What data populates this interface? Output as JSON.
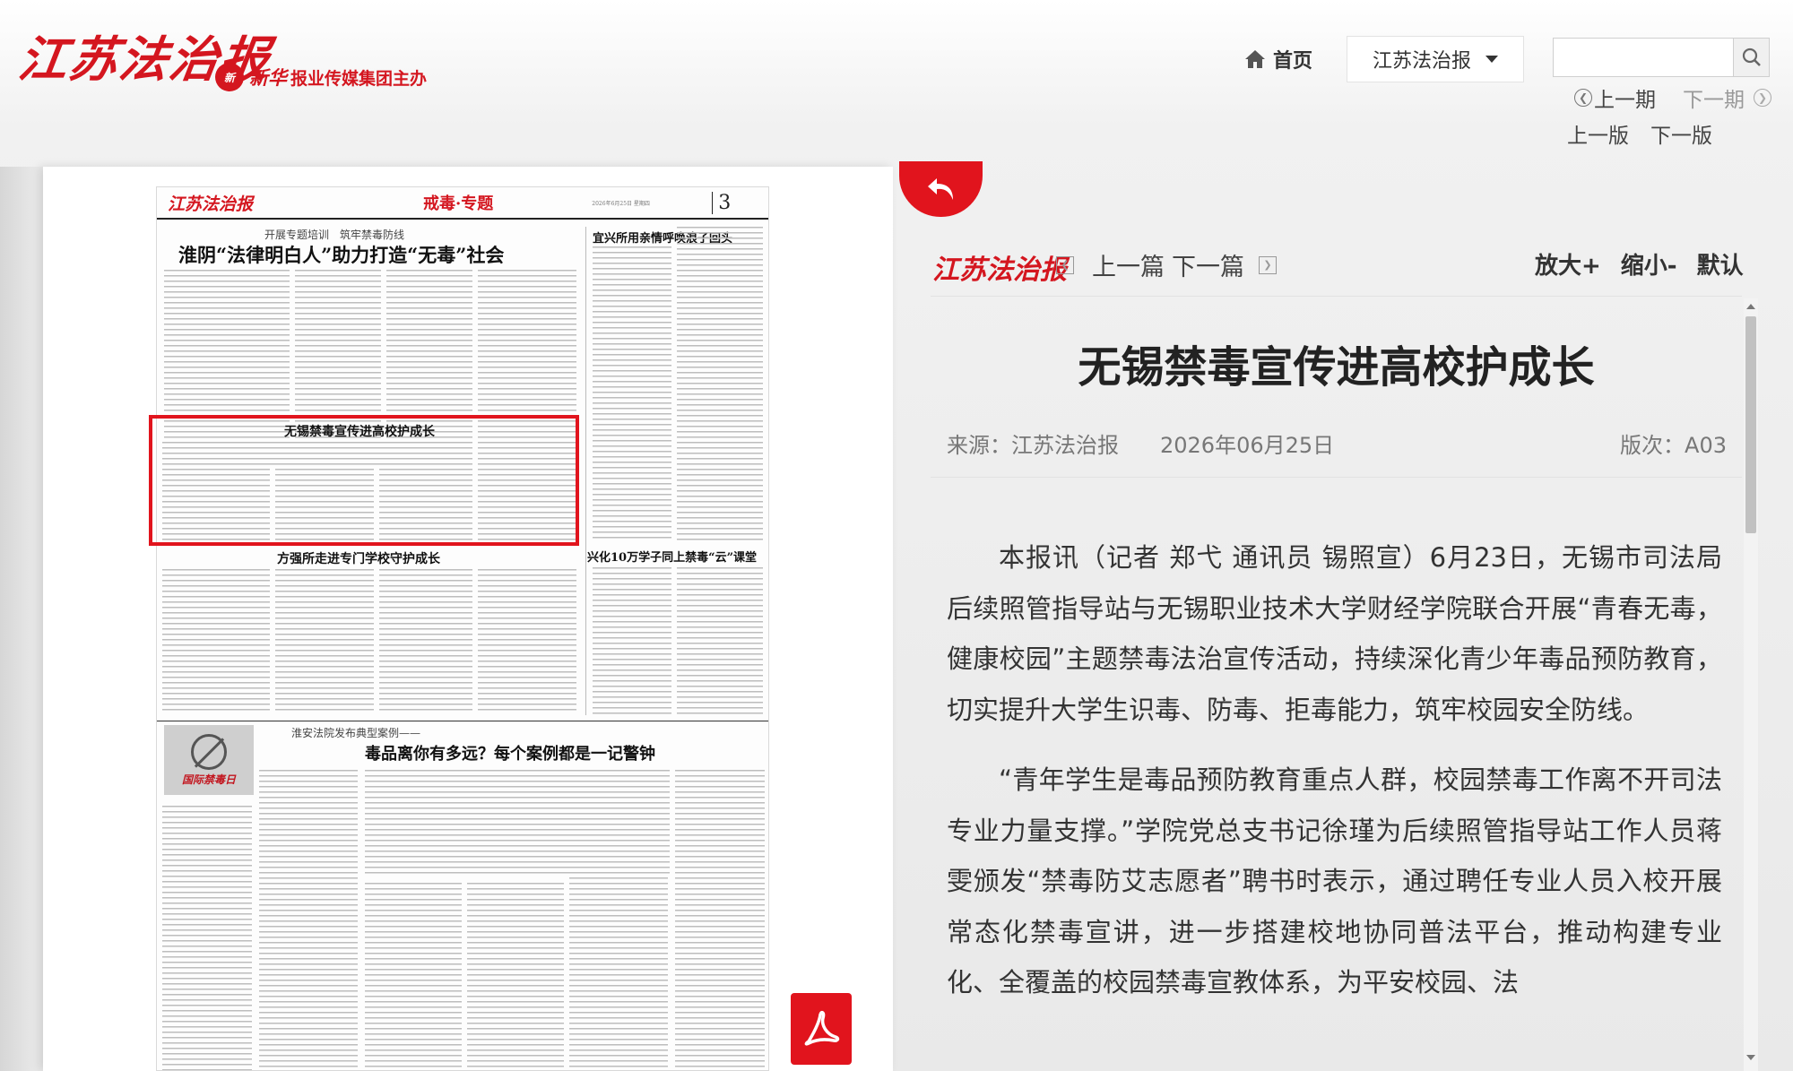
{
  "header": {
    "logo_text": "江苏法治报",
    "sponsor_brand": "新华",
    "sponsor_text": "报业传媒集团主办",
    "home_label": "首页",
    "paper_select": "江苏法治报",
    "search_placeholder": "",
    "prev_issue": "上一期",
    "next_issue": "下一期",
    "prev_page": "上一版",
    "next_page": "下一版"
  },
  "newspaper_page": {
    "masthead": "江苏法治报",
    "section": "戒毒·专题",
    "date_line": "2026年6月25日 星期四",
    "page_number": "3",
    "kicker1": "开展专题培训　筑牢禁毒防线",
    "headline1": "淮阴“法律明白人”助力打造“无毒”社会",
    "headline2": "宜兴所用亲情呼唤浪子回头",
    "headline3": "无锡禁毒宣传进高校护成长",
    "headline4": "兴化10万学子同上禁毒“云”课堂",
    "headline5": "方强所走进专门学校守护成长",
    "kicker2": "淮安法院发布典型案例——",
    "headline6": "毒品离你有多远？每个案例都是一记警钟",
    "photo_caption": "国际禁毒日"
  },
  "article": {
    "logo_text": "江苏法治报",
    "prev_article": "上一篇",
    "next_article": "下一篇",
    "zoom_in": "放大+",
    "zoom_out": "缩小-",
    "zoom_default": "默认",
    "title": "无锡禁毒宣传进高校护成长",
    "source": "来源：江苏法治报",
    "date": "2026年06月25日",
    "edition": "版次：A03",
    "paragraphs": [
      "本报讯（记者 郑弋 通讯员 锡照宣）6月23日，无锡市司法局后续照管指导站与无锡职业技术大学财经学院联合开展“青春无毒，健康校园”主题禁毒法治宣传活动，持续深化青少年毒品预防教育，切实提升大学生识毒、防毒、拒毒能力，筑牢校园安全防线。",
      "“青年学生是毒品预防教育重点人群，校园禁毒工作离不开司法专业力量支撑。”学院党总支书记徐瑾为后续照管指导站工作人员蒋雯颁发“禁毒防艾志愿者”聘书时表示，通过聘任专业人员入校开展常态化禁毒宣讲，进一步搭建校地协同普法平台，推动构建专业化、全覆盖的校园禁毒宣教体系，为平安校园、法"
    ]
  },
  "colors": {
    "brand_red": "#d4161f",
    "highlight_red": "#e1141d"
  }
}
